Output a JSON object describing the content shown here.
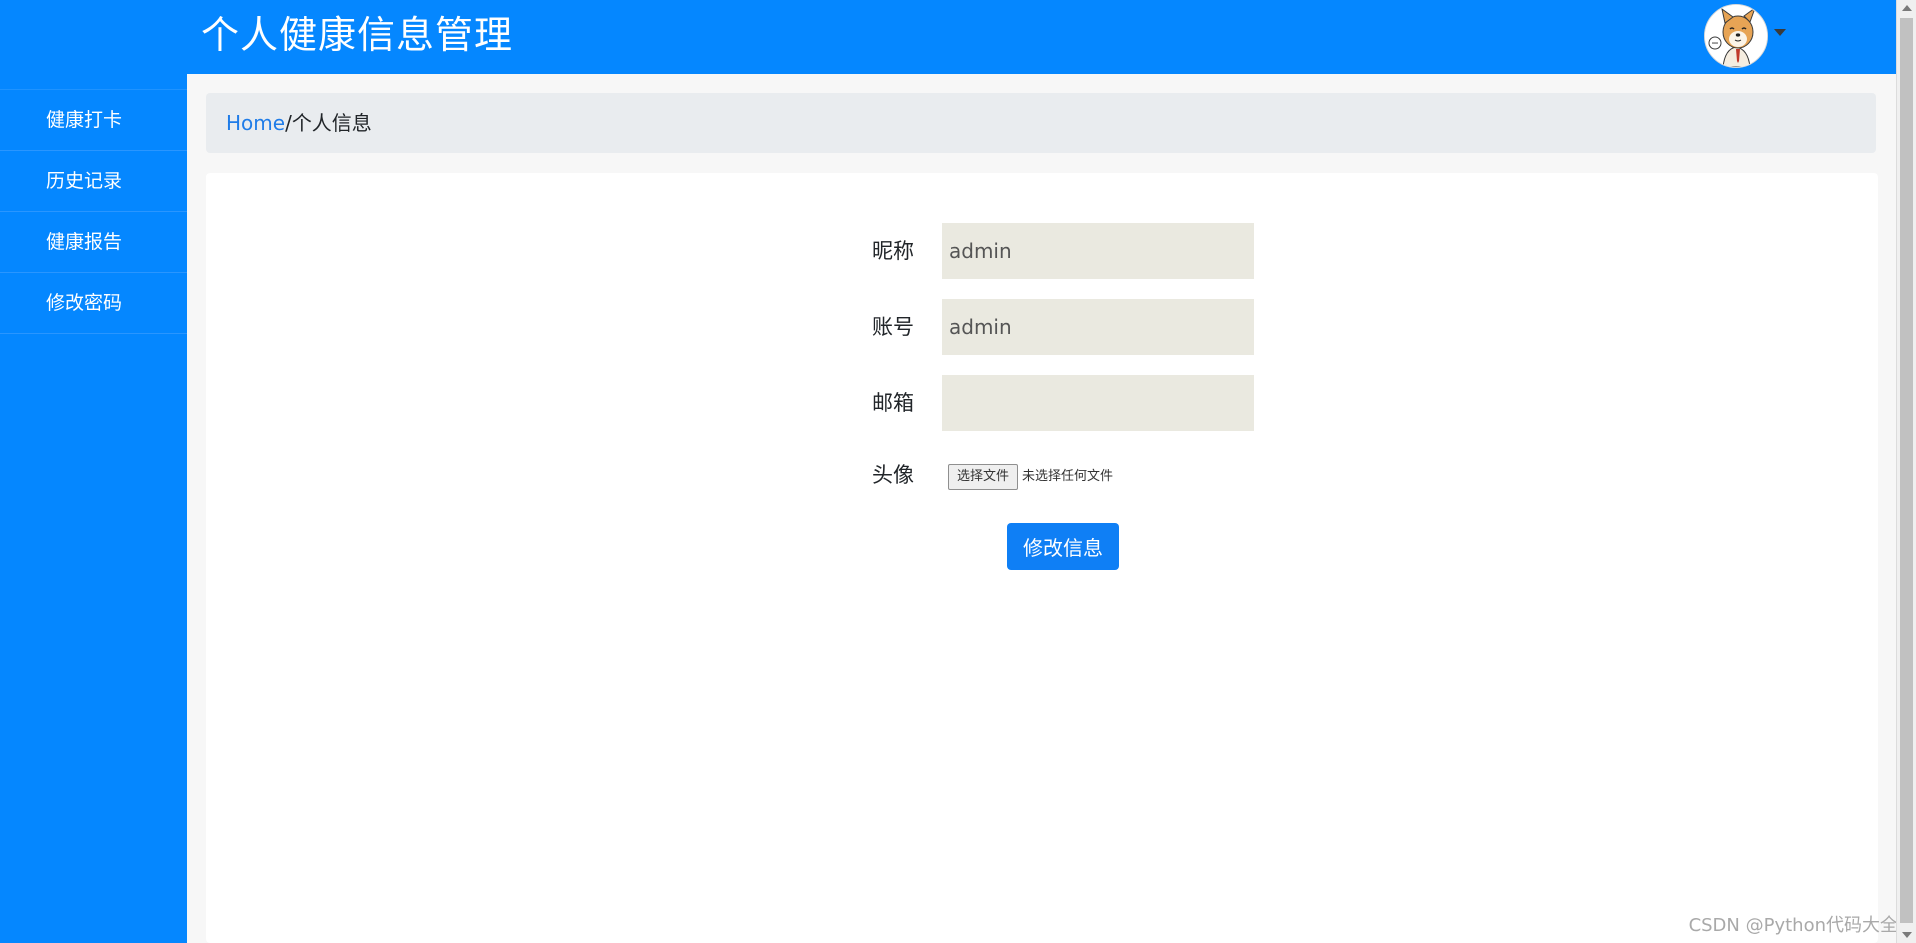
{
  "header": {
    "title": "个人健康信息管理",
    "avatar_icon": "shiba-dog-avatar-icon",
    "dropdown_icon": "caret-down-icon",
    "background_color": "#0587ff"
  },
  "sidebar": {
    "items": [
      {
        "label": "健康打卡"
      },
      {
        "label": "历史记录"
      },
      {
        "label": "健康报告"
      },
      {
        "label": "修改密码"
      }
    ]
  },
  "breadcrumb": {
    "home": "Home",
    "separator": "/",
    "current": "个人信息"
  },
  "form": {
    "nickname": {
      "label": "昵称",
      "value": "admin"
    },
    "account": {
      "label": "账号",
      "value": "admin"
    },
    "email": {
      "label": "邮箱",
      "value": ""
    },
    "avatar": {
      "label": "头像",
      "button_label": "选择文件",
      "status": "未选择任何文件"
    },
    "submit_label": "修改信息",
    "submit_color": "#0f7ff5"
  },
  "watermark": "CSDN @Python代码大全"
}
